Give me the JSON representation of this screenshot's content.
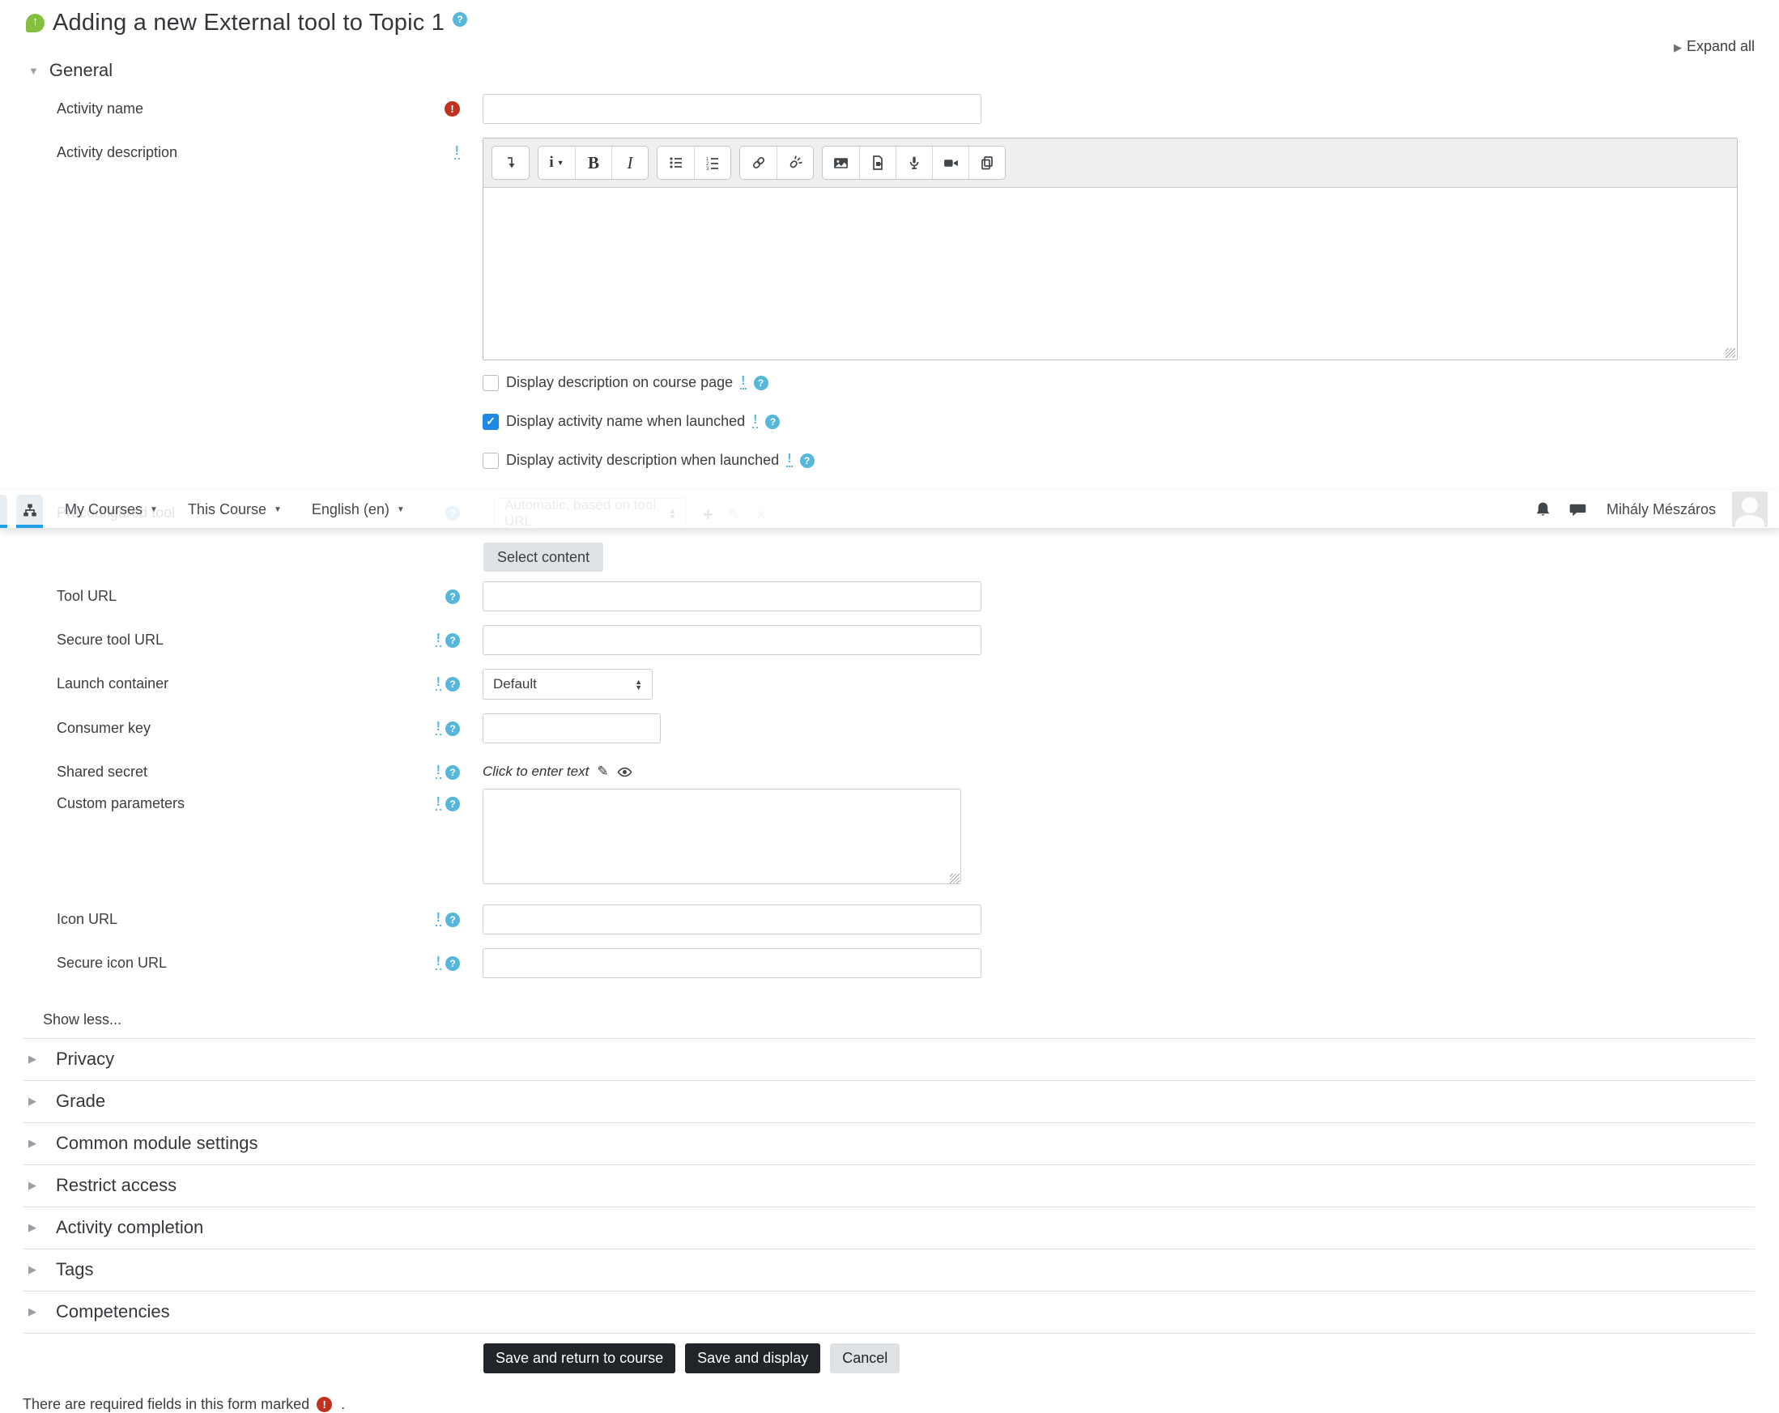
{
  "header": {
    "title": "Adding a new External tool to Topic 1",
    "expand_all": "Expand all"
  },
  "navbar": {
    "links": [
      "My Courses",
      "This Course",
      "English (en)"
    ],
    "user_name": "Mihály Mészáros"
  },
  "general": {
    "section_title": "General",
    "checkboxes": [
      {
        "label": "Display description on course page",
        "checked": false
      },
      {
        "label": "Display activity name when launched",
        "checked": true
      },
      {
        "label": "Display activity description when launched",
        "checked": false
      }
    ]
  },
  "form": {
    "activity_name": {
      "label": "Activity name"
    },
    "activity_description": {
      "label": "Activity description"
    },
    "preconfigured_tool": {
      "label": "Preconfigured tool",
      "value": "Automatic, based on tool URL"
    },
    "select_content_button": "Select content",
    "tool_url": {
      "label": "Tool URL"
    },
    "secure_tool_url": {
      "label": "Secure tool URL"
    },
    "launch_container": {
      "label": "Launch container",
      "value": "Default"
    },
    "consumer_key": {
      "label": "Consumer key"
    },
    "shared_secret": {
      "label": "Shared secret",
      "value": "Click to enter text"
    },
    "custom_parameters": {
      "label": "Custom parameters"
    },
    "icon_url": {
      "label": "Icon URL"
    },
    "secure_icon_url": {
      "label": "Secure icon URL"
    },
    "show_less": "Show less..."
  },
  "sections": [
    "Privacy",
    "Grade",
    "Common module settings",
    "Restrict access",
    "Activity completion",
    "Tags",
    "Competencies"
  ],
  "actions": {
    "save_return": "Save and return to course",
    "save_display": "Save and display",
    "cancel": "Cancel"
  },
  "footer": {
    "required_note": "There are required fields in this form marked",
    "suffix": "."
  },
  "glyphs": {
    "help": "?",
    "stale": "!",
    "required": "!",
    "check": "✓",
    "tri_right": "▶",
    "tri_down": "▼",
    "caret_up": "▲",
    "caret_down": "▼",
    "nav_caret": "▼",
    "add": "+",
    "edit_pencil": "✎",
    "delete_x": "✕",
    "up_arrow": "↑",
    "bold": "B",
    "italic": "I",
    "styles_i": "i"
  },
  "colors": {
    "primary_blue": "#1e88e5",
    "help_blue": "#56b7db",
    "danger_red": "#c0321f",
    "button_dark": "#212529",
    "lti_green": "#84bf3f",
    "nav_accent": "#22a0ea"
  }
}
